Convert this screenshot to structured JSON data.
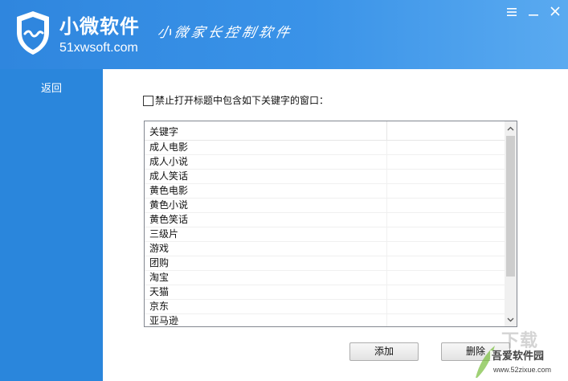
{
  "header": {
    "brand_name": "小微软件",
    "brand_url": "51xwsoft.com",
    "slogan": "小微家长控制软件"
  },
  "sidebar": {
    "items": [
      {
        "label": "返回"
      }
    ]
  },
  "option": {
    "checked": false,
    "label": "禁止打开标题中包含如下关键字的窗口："
  },
  "keyword_list": {
    "columns": [
      "关键字",
      ""
    ],
    "rows": [
      "成人电影",
      "成人小说",
      "成人笑话",
      "黄色电影",
      "黄色小说",
      "黄色笑话",
      "三级片",
      "游戏",
      "团购",
      "淘宝",
      "天猫",
      "京东",
      "亚马逊"
    ]
  },
  "buttons": {
    "add_label": "添加",
    "delete_label": "删除"
  },
  "watermark": {
    "text": "吾爱软件园",
    "url": "www.52zixue.com",
    "big_text": "下载"
  },
  "colors": {
    "header_blue": "#3a93e8",
    "sidebar_blue": "#2a86dc"
  }
}
